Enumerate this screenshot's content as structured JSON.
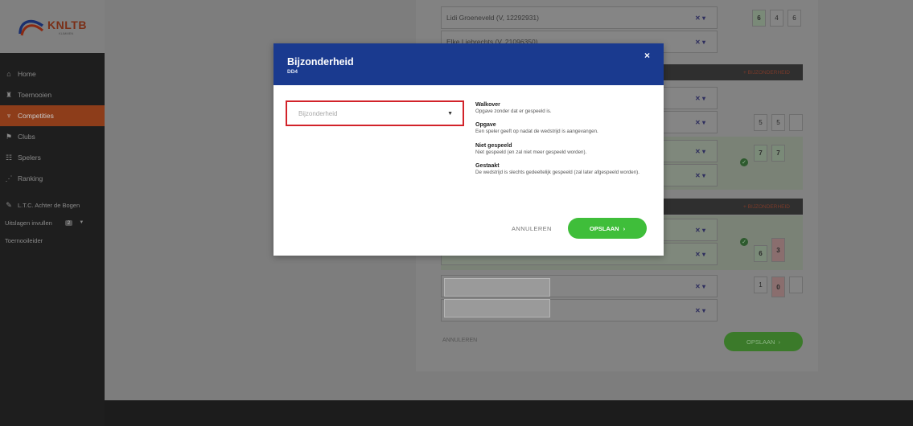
{
  "logo": {
    "text": "KNLTB",
    "sub": "KLIMMEN"
  },
  "nav": [
    {
      "label": "Home",
      "icon": "home-icon",
      "glyph": "⌂"
    },
    {
      "label": "Toernooien",
      "icon": "trophy-icon",
      "glyph": "♜"
    },
    {
      "label": "Competities",
      "icon": "cup-icon",
      "glyph": "♆"
    },
    {
      "label": "Clubs",
      "icon": "flag-icon",
      "glyph": "⚑"
    },
    {
      "label": "Spelers",
      "icon": "users-icon",
      "glyph": "☷"
    },
    {
      "label": "Ranking",
      "icon": "chart-icon",
      "glyph": "⋰"
    }
  ],
  "nav2": {
    "club": "L.T.C. Achter de Bogen",
    "uitslagen": "Uitslagen invullen",
    "uitslagen_badge": "2",
    "toernooileider": "Toernooileider"
  },
  "background": {
    "player1": "Lidi Groeneveld (V, 12292931)",
    "player2": "Elke Liebrechts (V, 21096350)",
    "bijzonderheid_btn": "+ BIJZONDERHEID",
    "x_mark": "✕ ▾",
    "scores_row1": [
      "6",
      "4",
      "6"
    ],
    "scores_row2": [
      "5",
      "5"
    ],
    "scores_row3": [
      "7",
      "7"
    ],
    "scores_row4": [
      "6",
      "3"
    ],
    "scores_row5": [
      "1",
      "0"
    ],
    "annuleren": "ANNULEREN",
    "opslaan": "OPSLAAN",
    "check": "✓"
  },
  "modal": {
    "title": "Bijzonderheid",
    "subtitle": "DD4",
    "close": "×",
    "select_placeholder": "Bijzonderheid",
    "options": [
      {
        "title": "Walkover",
        "text": "Opgave zonder dat er gespeeld is."
      },
      {
        "title": "Opgave",
        "text": "Een speler geeft op nadat de wedstrijd is aangevangen."
      },
      {
        "title": "Niet gespeeld",
        "text": "Niet gespeeld (en zal niet meer gespeeld worden)."
      },
      {
        "title": "Gestaakt",
        "text": "De wedstrijd is slechts gedeeltelijk gespeeld (zal later afgespeeld worden)."
      }
    ],
    "cancel": "ANNULEREN",
    "save": "OPSLAAN",
    "save_arrow": "›"
  },
  "colors": {
    "modal_header": "#1a3a8f",
    "save_green": "#3fbe3a",
    "highlight_red": "#d2232a",
    "nav_active": "#8d3d1a"
  }
}
